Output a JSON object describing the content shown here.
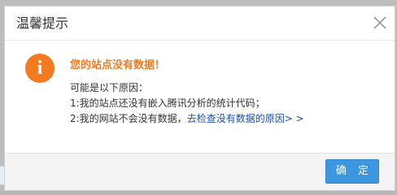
{
  "dialog": {
    "title": "温馨提示",
    "close_icon": "close-icon",
    "warning_icon": "info-exclamation-icon",
    "warning_glyph": "i",
    "message_title": "您的站点没有数据！",
    "reason_intro": "可能是以下原因：",
    "reason_1": "1:我的站点还没有嵌入腾讯分析的统计代码；",
    "reason_2_prefix": "2:我的网站不会没有数据，",
    "reason_2_link": "去检查没有数据的原因> >",
    "ok_button": "确 定"
  },
  "colors": {
    "accent_orange": "#f47a20",
    "button_blue": "#3c97e0",
    "link_blue": "#1a4fb0"
  }
}
